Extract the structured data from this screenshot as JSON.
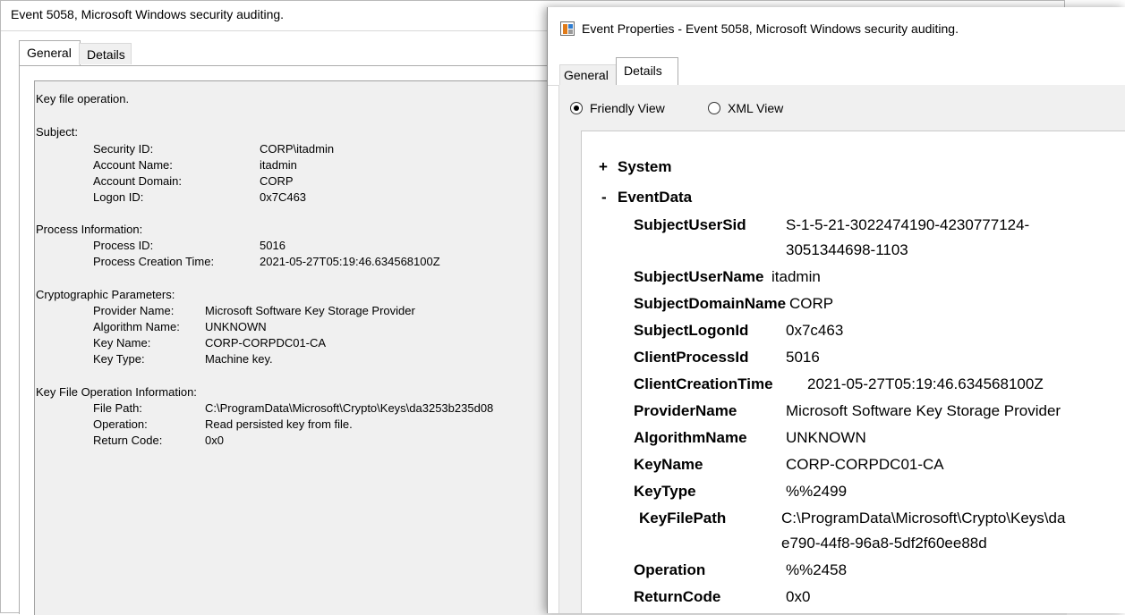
{
  "left_window": {
    "title": "Event 5058, Microsoft Windows security auditing.",
    "tabs": [
      {
        "label": "General"
      },
      {
        "label": "Details"
      }
    ],
    "message": {
      "intro": "Key file operation.",
      "subject_header": "Subject:",
      "subject": [
        {
          "label": "Security ID:",
          "value": "CORP\\itadmin"
        },
        {
          "label": "Account Name:",
          "value": "itadmin"
        },
        {
          "label": "Account Domain:",
          "value": "CORP"
        },
        {
          "label": "Logon ID:",
          "value": "0x7C463"
        }
      ],
      "process_header": "Process Information:",
      "process": [
        {
          "label": "Process ID:",
          "value": "5016"
        },
        {
          "label": "Process Creation Time:",
          "value": "2021-05-27T05:19:46.634568100Z"
        }
      ],
      "crypto_header": "Cryptographic Parameters:",
      "crypto": [
        {
          "label": "Provider Name:",
          "value": "Microsoft Software Key Storage Provider"
        },
        {
          "label": "Algorithm Name:",
          "value": "UNKNOWN"
        },
        {
          "label": "Key Name:",
          "value": "CORP-CORPDC01-CA"
        },
        {
          "label": "Key Type:",
          "value": "Machine key."
        }
      ],
      "keyfile_header": "Key File Operation Information:",
      "keyfile": [
        {
          "label": "File Path:",
          "value": "C:\\ProgramData\\Microsoft\\Crypto\\Keys\\da3253b235d08"
        },
        {
          "label": "Operation:",
          "value": "Read persisted key from file."
        },
        {
          "label": "Return Code:",
          "value": "0x0"
        }
      ]
    }
  },
  "right_window": {
    "title": "Event Properties - Event 5058, Microsoft Windows security auditing.",
    "app_icon": "event-viewer-icon",
    "tabs": [
      {
        "label": "General"
      },
      {
        "label": "Details"
      }
    ],
    "views": {
      "friendly": "Friendly View",
      "xml": "XML View",
      "selected": "friendly"
    },
    "tree": {
      "system": {
        "toggle": "+",
        "label": "System"
      },
      "eventdata": {
        "toggle": "-",
        "label": "EventData"
      }
    },
    "fields": [
      {
        "name": "SubjectUserSid",
        "value": "S-1-5-21-3022474190-4230777124-",
        "value2": "3051344698-1103"
      },
      {
        "name": "SubjectUserName",
        "value": "itadmin"
      },
      {
        "name": "SubjectDomainName",
        "value": "CORP"
      },
      {
        "name": "SubjectLogonId",
        "value": "0x7c463"
      },
      {
        "name": "ClientProcessId",
        "value": "5016"
      },
      {
        "name": "ClientCreationTime",
        "value": "2021-05-27T05:19:46.634568100Z"
      },
      {
        "name": "ProviderName",
        "value": "Microsoft Software Key Storage Provider"
      },
      {
        "name": "AlgorithmName",
        "value": "UNKNOWN"
      },
      {
        "name": "KeyName",
        "value": "CORP-CORPDC01-CA"
      },
      {
        "name": "KeyType",
        "value": "%%2499"
      },
      {
        "name": "KeyFilePath",
        "value": "C:\\ProgramData\\Microsoft\\Crypto\\Keys\\da",
        "value2": "e790-44f8-96a8-5df2f60ee88d"
      },
      {
        "name": "Operation",
        "value": "%%2458"
      },
      {
        "name": "ReturnCode",
        "value": "0x0"
      }
    ]
  }
}
